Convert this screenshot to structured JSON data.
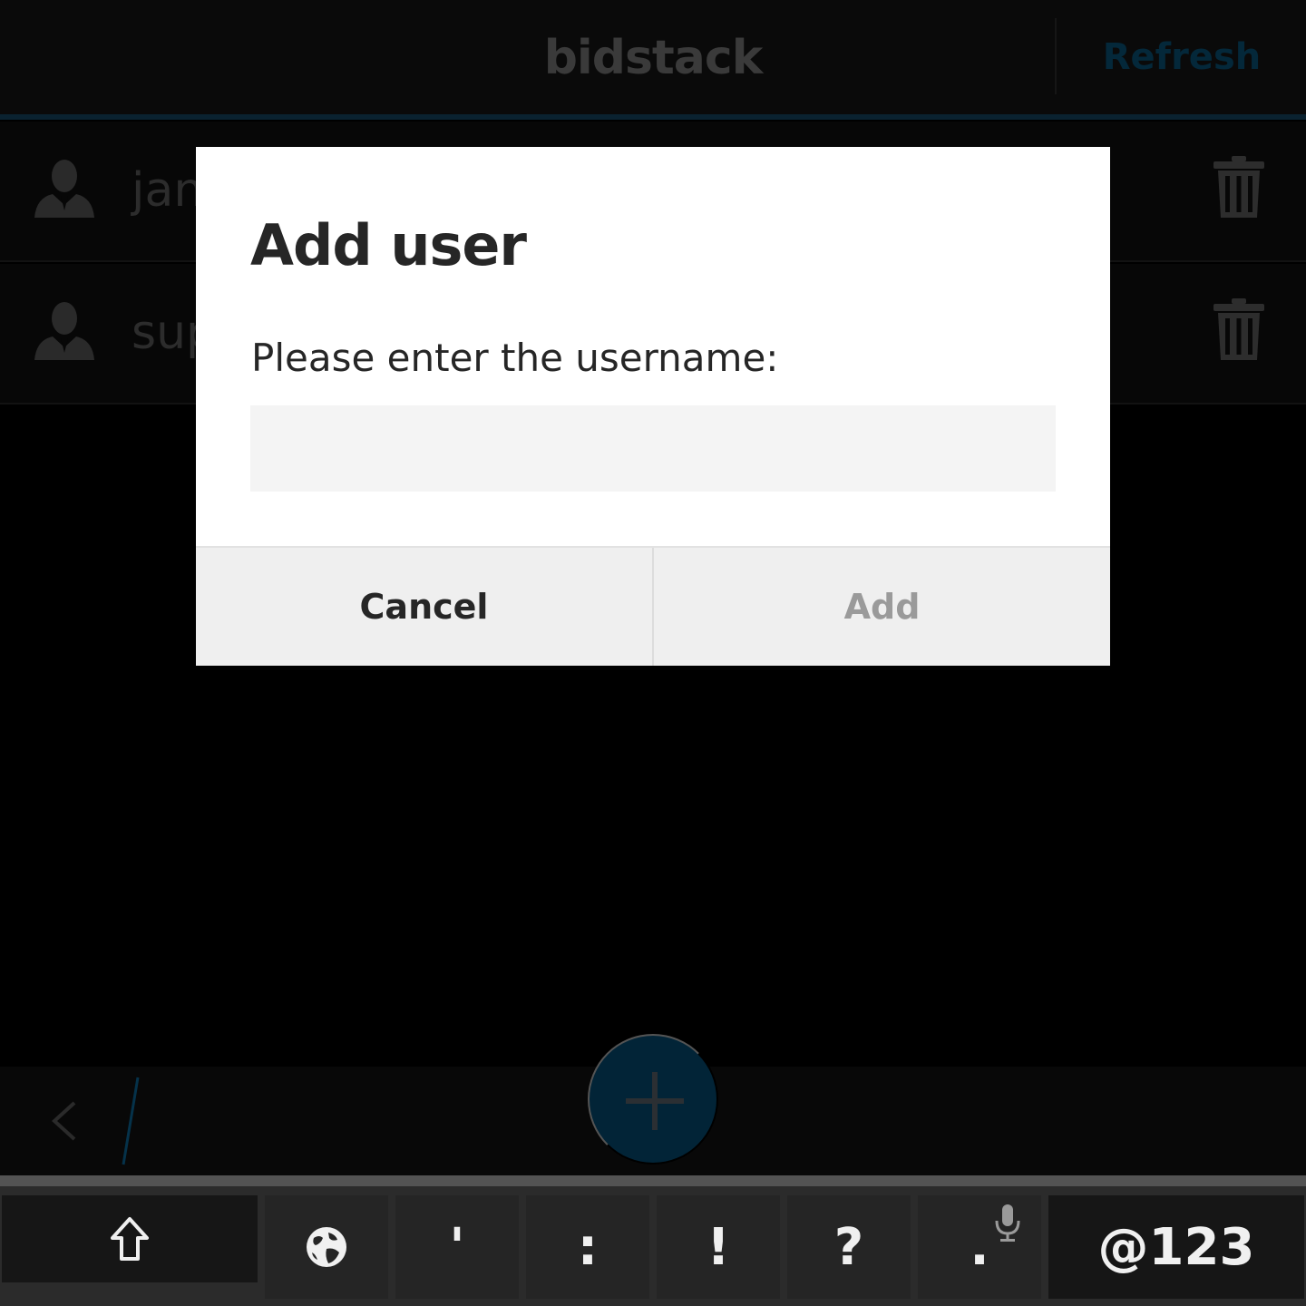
{
  "app": {
    "title": "bidstack",
    "refresh_label": "Refresh"
  },
  "users": [
    {
      "name": "jan",
      "avatar_icon": "user-avatar-icon",
      "delete_icon": "trash-icon"
    },
    {
      "name": "sup",
      "avatar_icon": "user-avatar-icon",
      "delete_icon": "trash-icon"
    }
  ],
  "dialog": {
    "title": "Add user",
    "prompt": "Please enter the username:",
    "input_value": "",
    "cancel_label": "Cancel",
    "add_label": "Add"
  },
  "action_bar": {
    "back_icon": "chevron-left-icon",
    "add_icon": "plus-icon"
  },
  "keyboard": {
    "shift_icon": "shift-arrow-icon",
    "globe_icon": "globe-icon",
    "keys": [
      "'",
      ":",
      "!",
      "?",
      "."
    ],
    "mic_icon": "microphone-icon",
    "symbols_label": "@123"
  },
  "colors": {
    "accent": "#022437",
    "dialog_bg": "#ffffff",
    "add_disabled": "#9a9a9a"
  }
}
